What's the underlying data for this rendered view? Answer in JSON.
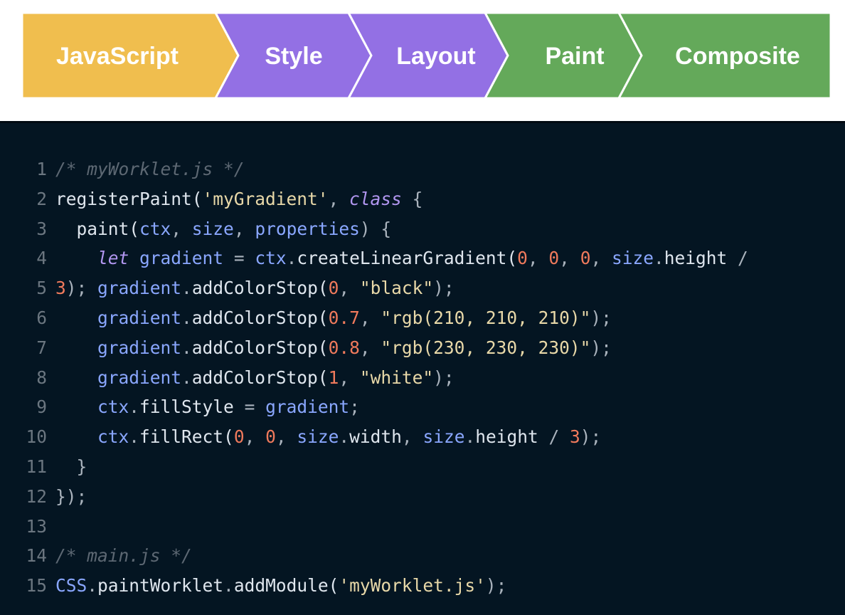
{
  "pipeline": {
    "stages": [
      {
        "label": "JavaScript",
        "color": "#f0be4e"
      },
      {
        "label": "Style",
        "color": "#9370e4"
      },
      {
        "label": "Layout",
        "color": "#9370e4"
      },
      {
        "label": "Paint",
        "color": "#64a95a"
      },
      {
        "label": "Composite",
        "color": "#64a95a"
      }
    ]
  },
  "code": {
    "lines": [
      {
        "n": "1",
        "tokens": [
          [
            "cmt",
            "/* myWorklet.js */"
          ]
        ]
      },
      {
        "n": "2",
        "tokens": [
          [
            "pl",
            "registerPaint("
          ],
          [
            "str",
            "'myGradient'"
          ],
          [
            "pn",
            ", "
          ],
          [
            "kw",
            "class"
          ],
          [
            "pn",
            " {"
          ]
        ]
      },
      {
        "n": "3",
        "tokens": [
          [
            "pl",
            "  paint("
          ],
          [
            "id",
            "ctx"
          ],
          [
            "pn",
            ", "
          ],
          [
            "id",
            "size"
          ],
          [
            "pn",
            ", "
          ],
          [
            "id",
            "properties"
          ],
          [
            "pn",
            ") {"
          ]
        ]
      },
      {
        "n": "4",
        "tokens": [
          [
            "pl",
            "    "
          ],
          [
            "kw",
            "let"
          ],
          [
            "pl",
            " "
          ],
          [
            "id",
            "gradient"
          ],
          [
            "pn",
            " = "
          ],
          [
            "id",
            "ctx"
          ],
          [
            "pn",
            "."
          ],
          [
            "pl",
            "createLinearGradient("
          ],
          [
            "num",
            "0"
          ],
          [
            "pn",
            ", "
          ],
          [
            "num",
            "0"
          ],
          [
            "pn",
            ", "
          ],
          [
            "num",
            "0"
          ],
          [
            "pn",
            ", "
          ],
          [
            "id",
            "size"
          ],
          [
            "pn",
            "."
          ],
          [
            "pl",
            "height"
          ],
          [
            "pn",
            " /"
          ]
        ]
      },
      {
        "n": "5",
        "tokens": [
          [
            "num",
            "3"
          ],
          [
            "pn",
            "); "
          ],
          [
            "id",
            "gradient"
          ],
          [
            "pn",
            "."
          ],
          [
            "pl",
            "addColorStop("
          ],
          [
            "num",
            "0"
          ],
          [
            "pn",
            ", "
          ],
          [
            "str",
            "\"black\""
          ],
          [
            "pn",
            ");"
          ]
        ]
      },
      {
        "n": "6",
        "tokens": [
          [
            "pl",
            "    "
          ],
          [
            "id",
            "gradient"
          ],
          [
            "pn",
            "."
          ],
          [
            "pl",
            "addColorStop("
          ],
          [
            "num",
            "0.7"
          ],
          [
            "pn",
            ", "
          ],
          [
            "str",
            "\"rgb(210, 210, 210)\""
          ],
          [
            "pn",
            ");"
          ]
        ]
      },
      {
        "n": "7",
        "tokens": [
          [
            "pl",
            "    "
          ],
          [
            "id",
            "gradient"
          ],
          [
            "pn",
            "."
          ],
          [
            "pl",
            "addColorStop("
          ],
          [
            "num",
            "0.8"
          ],
          [
            "pn",
            ", "
          ],
          [
            "str",
            "\"rgb(230, 230, 230)\""
          ],
          [
            "pn",
            ");"
          ]
        ]
      },
      {
        "n": "8",
        "tokens": [
          [
            "pl",
            "    "
          ],
          [
            "id",
            "gradient"
          ],
          [
            "pn",
            "."
          ],
          [
            "pl",
            "addColorStop("
          ],
          [
            "num",
            "1"
          ],
          [
            "pn",
            ", "
          ],
          [
            "str",
            "\"white\""
          ],
          [
            "pn",
            ");"
          ]
        ]
      },
      {
        "n": "9",
        "tokens": [
          [
            "pl",
            "    "
          ],
          [
            "id",
            "ctx"
          ],
          [
            "pn",
            "."
          ],
          [
            "pl",
            "fillStyle"
          ],
          [
            "pn",
            " = "
          ],
          [
            "id",
            "gradient"
          ],
          [
            "pn",
            ";"
          ]
        ]
      },
      {
        "n": "10",
        "tokens": [
          [
            "pl",
            "    "
          ],
          [
            "id",
            "ctx"
          ],
          [
            "pn",
            "."
          ],
          [
            "pl",
            "fillRect("
          ],
          [
            "num",
            "0"
          ],
          [
            "pn",
            ", "
          ],
          [
            "num",
            "0"
          ],
          [
            "pn",
            ", "
          ],
          [
            "id",
            "size"
          ],
          [
            "pn",
            "."
          ],
          [
            "pl",
            "width"
          ],
          [
            "pn",
            ", "
          ],
          [
            "id",
            "size"
          ],
          [
            "pn",
            "."
          ],
          [
            "pl",
            "height"
          ],
          [
            "pn",
            " / "
          ],
          [
            "num",
            "3"
          ],
          [
            "pn",
            ");"
          ]
        ]
      },
      {
        "n": "11",
        "tokens": [
          [
            "pn",
            "  }"
          ]
        ]
      },
      {
        "n": "12",
        "tokens": [
          [
            "pn",
            "});"
          ]
        ]
      },
      {
        "n": "13",
        "tokens": []
      },
      {
        "n": "14",
        "tokens": [
          [
            "cmt",
            "/* main.js */"
          ]
        ]
      },
      {
        "n": "15",
        "tokens": [
          [
            "id",
            "CSS"
          ],
          [
            "pn",
            "."
          ],
          [
            "pl",
            "paintWorklet"
          ],
          [
            "pn",
            "."
          ],
          [
            "pl",
            "addModule("
          ],
          [
            "str",
            "'myWorklet.js'"
          ],
          [
            "pn",
            ");"
          ]
        ]
      }
    ]
  }
}
